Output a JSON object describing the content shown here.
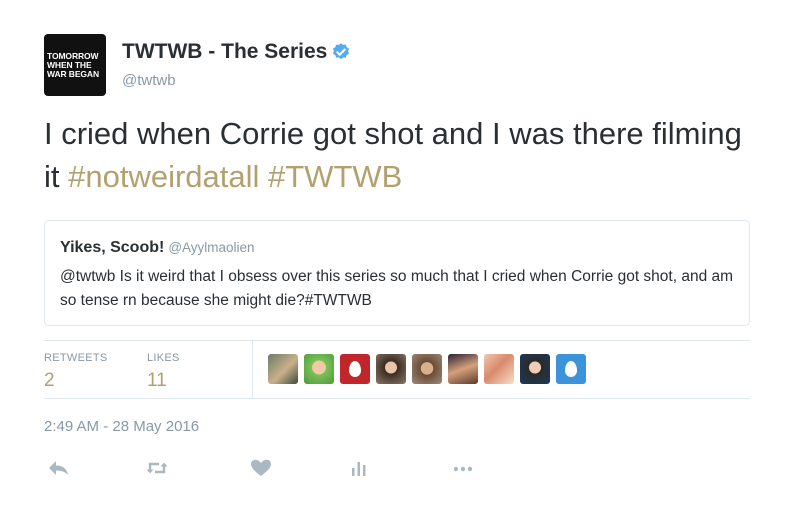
{
  "account": {
    "avatar_text": [
      "Tomorrow",
      "When the",
      "War Began"
    ],
    "display_name": "TWTWB - The Series",
    "handle": "@twtwb",
    "verified_icon": "verified-badge-icon"
  },
  "tweet": {
    "text_plain": "I cried when Corrie got shot and I was there filming it ",
    "hashtag_1": "#notweirdatall",
    "hashtag_2": "#TWTWB"
  },
  "quoted": {
    "name": "Yikes, Scoob!",
    "handle": "@Ayylmaolien",
    "text": "@twtwb Is it weird that I obsess over this series so much that I cried when Corrie got shot, and am so tense rn because she might die?#TWTWB"
  },
  "stats": {
    "retweets_label": "RETWEETS",
    "retweets_value": "2",
    "likes_label": "LIKES",
    "likes_value": "11"
  },
  "timestamp": "2:49 AM - 28 May 2016",
  "actions": [
    "reply-icon",
    "retweet-icon",
    "like-icon",
    "analytics-icon",
    "more-icon"
  ],
  "colors": {
    "hashtag": "#b3a06f",
    "verified": "#55acee",
    "muted": "#8899a6",
    "egg_red": "#c0262c",
    "egg_blue": "#3b94d9"
  }
}
